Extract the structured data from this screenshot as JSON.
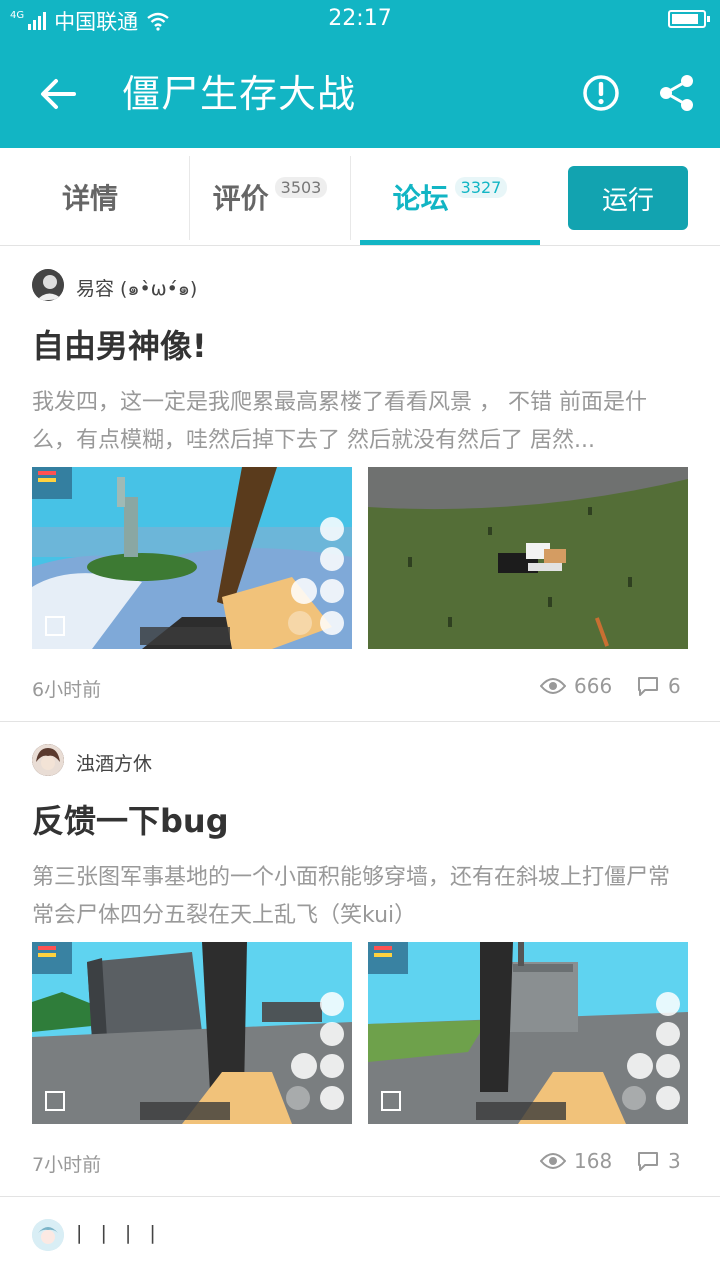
{
  "status_bar": {
    "network": "4G",
    "carrier": "中国联通",
    "time": "22:17"
  },
  "header": {
    "title": "僵尸生存大战",
    "back_icon": "arrow-left-icon",
    "report_icon": "exclamation-circle-icon",
    "share_icon": "share-icon"
  },
  "tabs": [
    {
      "label": "详情",
      "count": ""
    },
    {
      "label": "评价",
      "count": "3503"
    },
    {
      "label": "论坛",
      "count": "3327",
      "active": true
    }
  ],
  "run_button": "运行",
  "colors": {
    "accent": "#12b5c4",
    "run_button": "#12a3b0",
    "text_gray": "#999999"
  },
  "posts": [
    {
      "author": "易容 (๑•̀ω•́๑)",
      "title": "自由男神像!",
      "excerpt": "我发四，这一定是我爬累最高累楼了看看风景 ， 不错 前面是什么，有点模糊，哇然后掉下去了  然后就没有然后了 居然...",
      "time": "6小时前",
      "views": "666",
      "comments": "6"
    },
    {
      "author": "浊酒方休",
      "title": "反馈一下bug",
      "excerpt": "第三张图军事基地的一个小面积能够穿墙，还有在斜坡上打僵尸常常会尸体四分五裂在天上乱飞（笑kui）",
      "time": "7小时前",
      "views": "168",
      "comments": "3"
    },
    {
      "author": "| | | |",
      "title": ""
    }
  ]
}
